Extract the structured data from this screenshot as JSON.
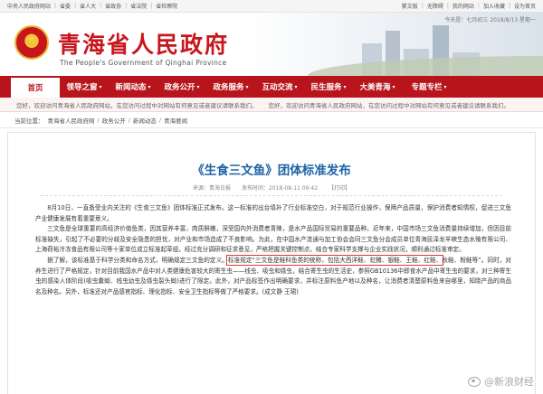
{
  "topbar": {
    "left": [
      "中央人民政府网站",
      "省委",
      "省人大",
      "省政协",
      "省法院",
      "省检察院"
    ],
    "right": [
      "繁文版",
      "无障碍",
      "我的网站",
      "加入收藏",
      "设为首页"
    ]
  },
  "header": {
    "site_title": "青海省人民政府",
    "site_subtitle": "The People's Government of Qinghai Province",
    "datestamp": "今天是：七月初三  2018/8/13 星期一"
  },
  "nav": {
    "items": [
      "首页",
      "领导之窗",
      "新闻动态",
      "政务公开",
      "政务服务",
      "互动交流",
      "民生服务",
      "大美青海",
      "专题专栏"
    ]
  },
  "marquee": {
    "text": "您好，欢迎访问青海省人民政府网站，在您访问过程中对网站有何意见或者建议请联系我们。"
  },
  "breadcrumb": {
    "label": "当前位置：",
    "items": [
      "青海省人民政府网",
      "政务公开",
      "新闻动态",
      "青海要闻"
    ]
  },
  "article": {
    "title": "《生食三文鱼》团体标准发布",
    "meta": [
      "来源：青海日报",
      "发布时间：2018-08-11 09:42",
      "【打印】"
    ],
    "paragraphs": [
      "8月10日，一直备受业内关注的《生食三文鱼》团体标准正式发布。这一标准的出台填补了行业标准空白，对于规范行业操作，保障产品质量，保护消费者知情权，促进三文鱼产业健康发展有着重要意义。",
      "三文鱼是全球重要的高经济价值鱼类，因其营养丰富，肉质鲜嫩，深受国内外消费者青睐，是水产品国际贸易的重要品种。近年来，中国市场三文鱼消费量持续增加，但因目前标准缺失，引起了不必要的分歧及安全隐患的担忧，对产业和市场造成了不良影响。为此，在中国水产流通与加工协会会同三文鱼分会成员单位青海民泽龙羊峡生态水殖有限公司、上海荷裕冷冻食品有限公司等十家单位成立标准起草组，经过充分调研和征求意见，严格把握关键控制点，结合专家科学支撑与企业实践状况，顺利通过标准审定。"
    ],
    "p3_before": "据了解，该标准基于科学分类和命名方式，明确规定三文鱼的定义。",
    "p3_highlight": "标准规定“三文鱼是鲑科鱼类的统称，包括大西洋鲑、虹鳟、银鲑、王鲑、红鲑、",
    "p3_after": "秋鲑、粉鲑等”。同时，对养生进行了严格规定，针对目前我国水产品中对人类健康危害较大的寄生虫——线虫、吸虫和绦虫，结合寄生虫的生活史，参照GB10136中即食水产品中寄生虫的要求，对三种寄生虫的感染人体阶段(吸虫囊蚴、线虫幼虫及绦虫裂头蚴)进行了限定。此外，对产品标签作出明确要求，并标注原料鱼产地以及种名，让消费者清楚原料鱼来自哪里，知晓产品的商品名及种名。另外，标准还对产品感官指标、理化指标、安全卫生指标等做了严格要求。(成文静 王珺)"
  },
  "watermark": "@新浪财经"
}
